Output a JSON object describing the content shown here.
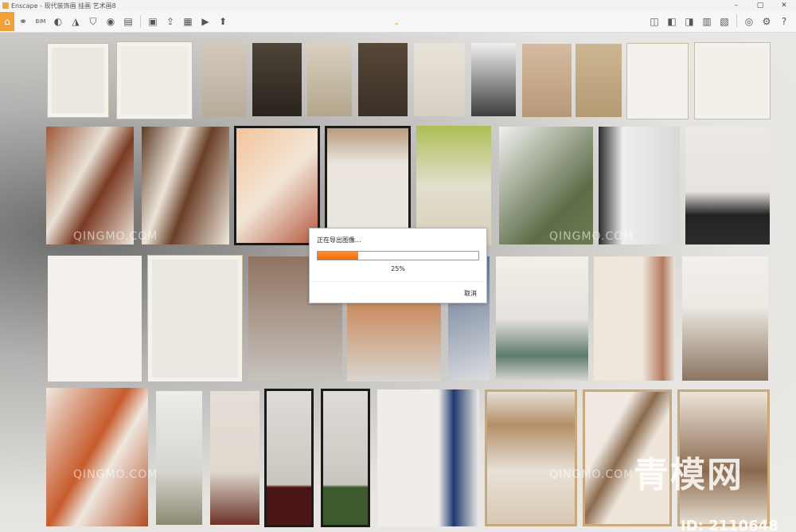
{
  "window": {
    "title": "Enscape - 现代装饰画 挂画 艺术画8",
    "controls": [
      "minimize-icon",
      "maximize-icon",
      "close-icon"
    ]
  },
  "toolbar": {
    "left_icons": [
      "home-icon",
      "link-icon",
      "bim-icon",
      "render-settings-icon",
      "hide-icon",
      "shield-icon",
      "camera-icon",
      "sync-views-icon",
      "document-icon",
      "clipboard-icon",
      "screenshot-icon",
      "video-icon",
      "export-icon",
      "batch-icon",
      "upload-icon"
    ],
    "right_icons": [
      "map-icon",
      "material-icon",
      "box-icon",
      "building-icon",
      "chart-icon",
      "settings-icon",
      "eye-icon",
      "gear-icon",
      "help-icon"
    ],
    "collapse": "⌃"
  },
  "dialog": {
    "title": "正在导出图像...",
    "progress": 0.25,
    "progress_label": "25%",
    "cancel_label": "取消"
  },
  "watermarks": {
    "brand": "QINGMO.COM",
    "brand_cn": "青模网",
    "id": "ID: 2110648"
  },
  "colors": {
    "accent": "#f0a13a",
    "progress": "#f06a00"
  }
}
